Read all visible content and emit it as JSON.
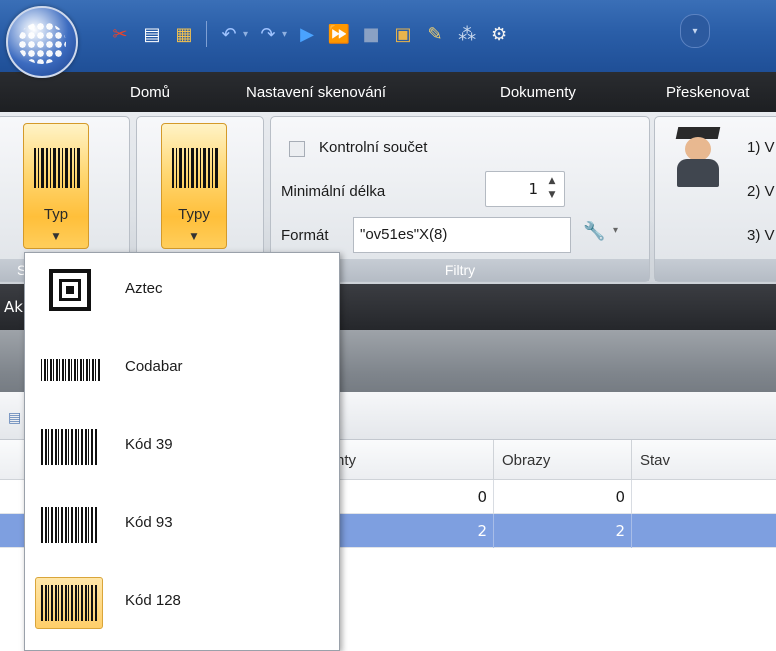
{
  "quick_access": {
    "icons": [
      "scissors-icon",
      "copy-icon",
      "paste-icon",
      "undo-icon",
      "redo-icon",
      "play-icon",
      "fast-forward-icon",
      "stop-icon",
      "scan-icon",
      "edit-icon",
      "network-icon",
      "settings-icon"
    ],
    "customize": "▾"
  },
  "tabs": {
    "home": "Domů",
    "scan_settings": "Nastavení skenování",
    "documents": "Dokumenty",
    "rescan": "Přeskenovat"
  },
  "ribbon": {
    "type_button": "Typ",
    "types_button": "Typy",
    "group1_label_fragment": "S",
    "checksum_label": "Kontrolní součet",
    "min_length_label": "Minimální délka",
    "min_length_value": "1",
    "format_label": "Formát",
    "format_value": "\"ov51es\"X(8)",
    "filters_group_label": "Filtry",
    "steps": [
      "1) V",
      "2) V",
      "3) V"
    ]
  },
  "dark_bar_text": "Ak",
  "grid": {
    "columns": [
      "nty",
      "Obrazy",
      "Stav"
    ],
    "rows": [
      {
        "documents": "0",
        "images": "0",
        "status": "",
        "selected": false
      },
      {
        "documents": "2",
        "images": "2",
        "status": "",
        "selected": true
      }
    ]
  },
  "barcode_menu": {
    "items": [
      {
        "label": "Aztec",
        "icon": "aztec-barcode-icon",
        "selected": false
      },
      {
        "label": "Codabar",
        "icon": "codabar-barcode-icon",
        "selected": false
      },
      {
        "label": "Kód 39",
        "icon": "code39-barcode-icon",
        "selected": false
      },
      {
        "label": "Kód 93",
        "icon": "code93-barcode-icon",
        "selected": false
      },
      {
        "label": "Kód 128",
        "icon": "code128-barcode-icon",
        "selected": true
      }
    ]
  },
  "colors": {
    "title_blue": "#2a5ea8",
    "tab_dark": "#1d1f22",
    "highlight_orange": "#ffbf3a",
    "selection_blue": "#7e9fe0"
  }
}
